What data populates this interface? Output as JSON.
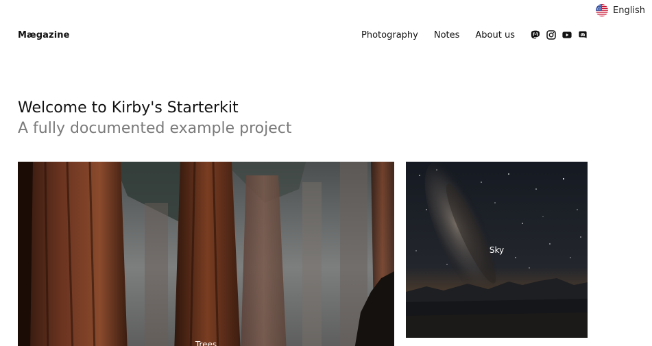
{
  "language": {
    "label": "English",
    "flag": "us-flag-icon"
  },
  "header": {
    "logo": "Mægazine",
    "nav": [
      {
        "label": "Photography"
      },
      {
        "label": "Notes"
      },
      {
        "label": "About us"
      }
    ],
    "social": [
      "mastodon-icon",
      "instagram-icon",
      "youtube-icon",
      "discord-icon"
    ]
  },
  "intro": {
    "title": "Welcome to Kirby's Starterkit",
    "subtitle": "A fully documented example project"
  },
  "albums": [
    {
      "label": "Trees"
    },
    {
      "label": "Sky"
    }
  ],
  "colors": {
    "text": "#111111",
    "subtitle": "#7a7a7a"
  }
}
